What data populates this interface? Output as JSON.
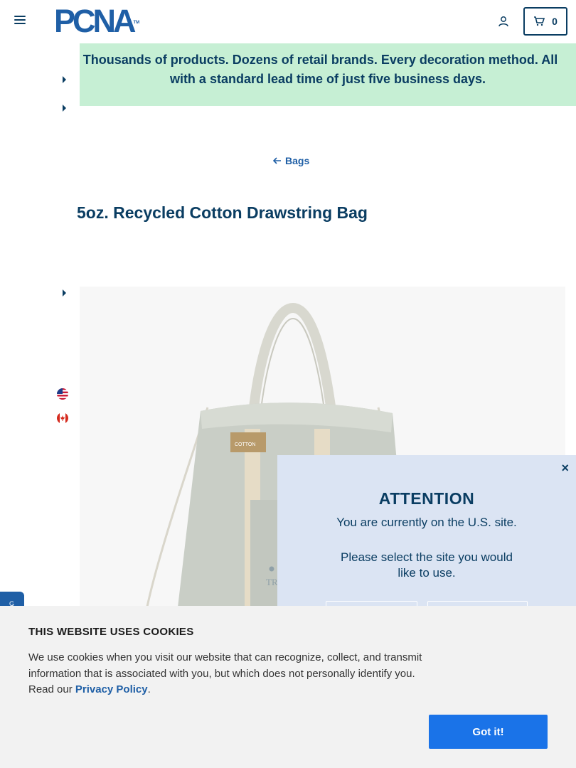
{
  "header": {
    "logo_text": "PCNA",
    "logo_tm": "TM",
    "cart_count": "0"
  },
  "banner": {
    "line1": "’ Thousands of products. Dozens of retail brands. Every decoration method. All",
    "line2": "with a standard lead time of just five business days."
  },
  "breadcrumb": {
    "back_label": "Bags"
  },
  "product": {
    "title": "5oz. Recycled Cotton Drawstring Bag",
    "tag_text": "COTTON",
    "print_text": "TR STI"
  },
  "side_tab": {
    "label": "G"
  },
  "modal": {
    "close": "×",
    "title": "ATTENTION",
    "text1": "You are currently on the U.S. site.",
    "text2": "Please select the site you would like to use."
  },
  "cookies": {
    "title": "THIS WEBSITE USES COOKIES",
    "text": "We use cookies when you visit our website that can recognize, collect, and transmit information that is associated with you, but which does not personally identify you. Read our ",
    "link": "Privacy Policy",
    "period": ".",
    "button": "Got it!"
  },
  "colors": {
    "navy": "#0a3d62",
    "brand_blue": "#1f5fa6",
    "banner_green": "#c6efd4",
    "modal_bg": "#dbe4f3",
    "cookie_button": "#1a73e8"
  }
}
